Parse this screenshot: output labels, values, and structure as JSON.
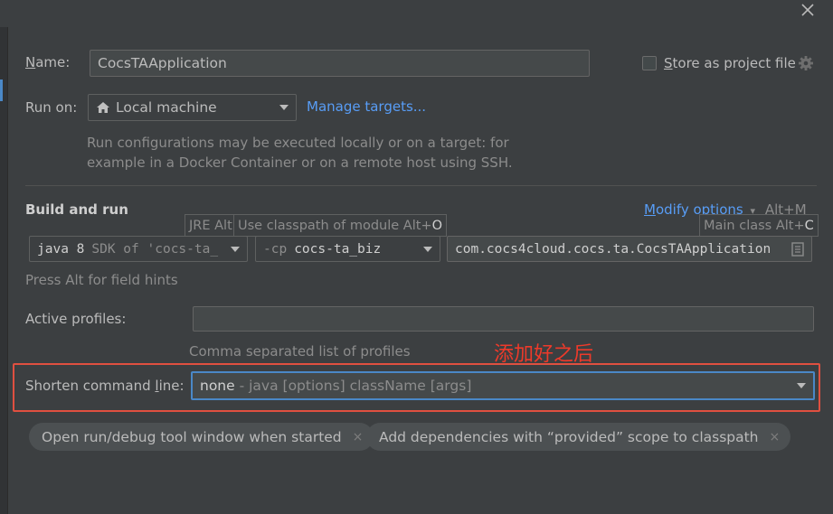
{
  "dialog": {
    "close_icon": "close-icon"
  },
  "name_row": {
    "label_u": "N",
    "label_rest": "ame:",
    "value": "CocsTAApplication"
  },
  "store_row": {
    "label_u": "S",
    "label_rest": "tore as project file",
    "checked": false,
    "icon": "gear-icon"
  },
  "run_on": {
    "label": "Run on:",
    "value": "Local machine",
    "icon": "home-icon",
    "manage_link": "Manage targets..."
  },
  "run_on_desc": {
    "line1": "Run configurations may be executed locally or on a target: for",
    "line2": "example in a Docker Container or on a remote host using SSH."
  },
  "build": {
    "title": "Build and run",
    "modify_options_u": "M",
    "modify_options_rest": "odify options",
    "modify_options_shortcut": "Alt+M",
    "jre_tooltip": "JRE Alt",
    "classpath_tooltip_text": "Use classpath of module Alt+",
    "classpath_tooltip_key": "O",
    "mainclass_tooltip_text": "Main class Alt+",
    "mainclass_tooltip_key": "C",
    "jdk_value": "java 8",
    "jdk_hint": "SDK of 'cocs-ta_",
    "cp_flag": "-cp",
    "cp_module": "cocs-ta_biz",
    "main_class": "com.cocs4cloud.cocs.ta.CocsTAApplication",
    "field_hint": "Press Alt for field hints"
  },
  "profiles": {
    "label": "Active profiles:",
    "value": "",
    "hint": "Comma separated list of profiles"
  },
  "annotation": "添加好之后",
  "shorten": {
    "label_prefix": "Shorten command ",
    "label_u": "l",
    "label_rest": "ine:",
    "value": "none",
    "value_hint": " - java [options] className [args]"
  },
  "chips": [
    {
      "label": "Open run/debug tool window when started",
      "close": "×"
    },
    {
      "label": "Add dependencies with “provided” scope to classpath",
      "close": "×"
    }
  ],
  "colors": {
    "background": "#3c3f41",
    "link": "#589df6",
    "annotation": "#ee3a2a",
    "focus": "#4a88c7"
  }
}
